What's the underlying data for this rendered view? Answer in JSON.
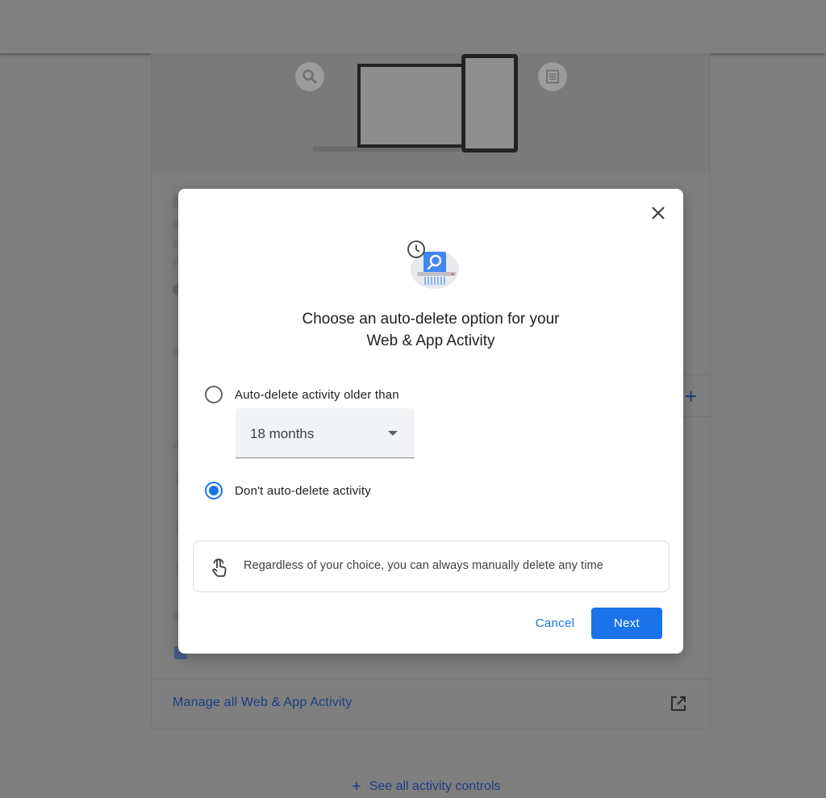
{
  "background": {
    "manage_link": "Manage all Web & App Activity",
    "see_all_link": "See all activity controls",
    "see_all_icon": "plus-icon",
    "manage_icon": "open-in-new-icon"
  },
  "dialog": {
    "close_icon": "close-icon",
    "illustration_icon": "auto-delete-search-history-illustration",
    "title_line1": "Choose an auto-delete option for your",
    "title_line2": "Web & App Activity",
    "options": [
      {
        "label": "Auto-delete activity older than",
        "selected": false
      },
      {
        "label": "Don't auto-delete activity",
        "selected": true
      }
    ],
    "period_select": {
      "value": "18 months"
    },
    "info": {
      "icon": "touch-hand-icon",
      "text": "Regardless of your choice, you can always manually delete any time"
    },
    "buttons": {
      "cancel": "Cancel",
      "next": "Next"
    },
    "colors": {
      "accent": "#1a73e8",
      "scrim": "#7f7f7f"
    }
  }
}
